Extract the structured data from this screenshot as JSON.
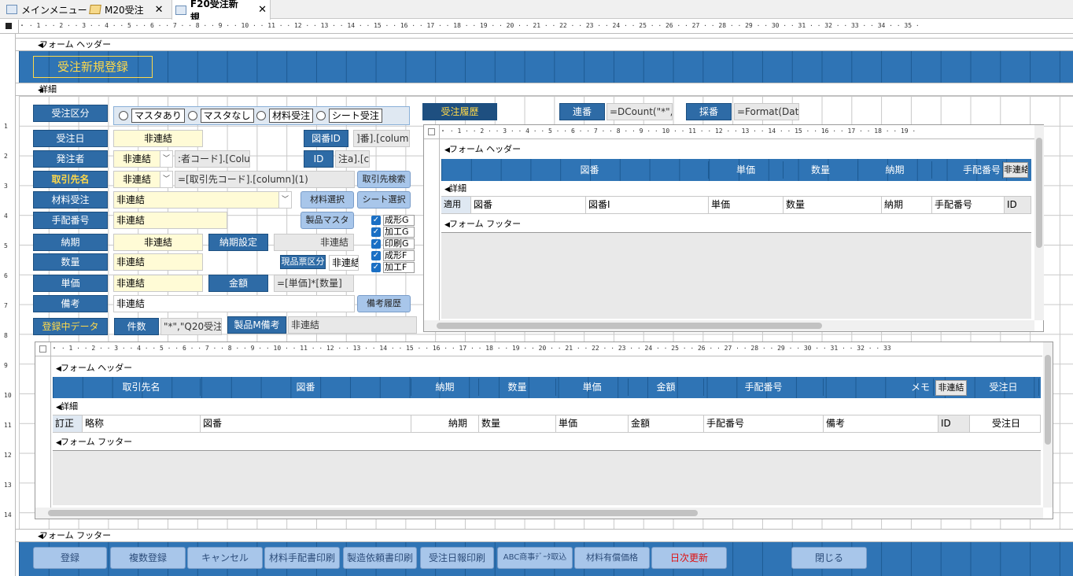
{
  "tabs": [
    {
      "label": "メインメニュー",
      "icon": "form-icon"
    },
    {
      "label": "M20受注",
      "icon": "query-icon"
    },
    {
      "label": "F20受注新規",
      "icon": "form-icon",
      "active": true
    }
  ],
  "ruler_main": "・ · 1 · · 2 · · 3 · · 4 · · 5 · · 6 · · 7 · · 8 · · 9 · · 10 · · 11 · · 12 · · 13 · · 14 · · 15 · · 16 · · 17 · · 18 · · 19 · · 20 · · 21 · · 22 · · 23 · · 24 · · 25 · · 26 · · 27 · · 28 · · 29 · · 30 · · 31 · · 32 · · 33 · · 34 · · 35 ·",
  "sections": {
    "form_header": "フォーム ヘッダー",
    "detail": "詳細",
    "form_footer": "フォーム フッター"
  },
  "header": {
    "title": "受注新規登録"
  },
  "detail": {
    "order_type_label": "受注区分",
    "order_type_options": [
      "マスタあり",
      "マスタなし",
      "材料受注",
      "シート受注"
    ],
    "history_label": "受注履歴",
    "serial_label": "連番",
    "serial_value": "=DCount(\"*\",",
    "saiban_label": "採番",
    "saiban_value": "=Format(Dat",
    "order_date_label": "受注日",
    "order_date_value": "非連結",
    "drawing_id_label": "図番ID",
    "drawing_id_value": "]番].[columr",
    "orderer_label": "発注者",
    "orderer_value": "非連結",
    "orderer_code": ":者コード].[Colur",
    "id_label": "ID",
    "id_value": "注a].[cc",
    "client_label": "取引先名",
    "client_value": "非連結",
    "client_code": "=[取引先コード].[column](1)",
    "client_search_btn": "取引先検索",
    "material_label": "材料受注",
    "material_value": "非連結",
    "material_select_btn": "材料選択",
    "sheet_select_btn": "シート選択",
    "arrange_label": "手配番号",
    "arrange_value": "非連結",
    "product_master_btn": "製品マスタ",
    "checks": [
      "成形G",
      "加工G",
      "印刷G",
      "成形F",
      "加工F"
    ],
    "delivery_label": "納期",
    "delivery_value": "非連結",
    "delivery_set_label": "納期設定",
    "delivery_set_value": "非連結",
    "qty_label": "数量",
    "qty_value": "非連結",
    "genpin_label": "現品票区分",
    "genpin_value": "非連結",
    "price_label": "単価",
    "price_value": "非連結",
    "amount_label": "金額",
    "amount_value": "=[単価]*[数量]",
    "remarks_label": "備考",
    "remarks_value": "非連結",
    "remarks_history_btn": "備考履歴",
    "registering_label": "登録中データ",
    "count_label": "件数",
    "count_value": "\"*\",\"Q20受注",
    "product_remarks_label": "製品M備考",
    "product_remarks_value": "非連結"
  },
  "sub1": {
    "ruler": "・ · 1 · · 2 · · 3 · · 4 · · 5 · · 6 · · 7 · · 8 · · 9 · · 10 · · 11 · · 12 · · 13 · · 14 · · 15 · · 16 · · 17 · · 18 · · 19 ·",
    "headers": [
      "図番",
      "単価",
      "数量",
      "納期",
      "手配番号"
    ],
    "header_unbound": "非連絡",
    "detail_cells": [
      "適用",
      "図番",
      "図番I",
      "単価",
      "数量",
      "納期",
      "手配番号",
      "ID"
    ]
  },
  "sub2": {
    "ruler": "・ · 1 · · 2 · · 3 · · 4 · · 5 · · 6 · · 7 · · 8 · · 9 · · 10 · · 11 · · 12 · · 13 · · 14 · · 15 · · 16 · · 17 · · 18 · · 19 · · 20 · · 21 · · 22 · · 23 · · 24 · · 25 · · 26 · · 27 · · 28 · · 29 · · 30 · · 31 · · 32 · · 33",
    "headers": [
      "取引先名",
      "図番",
      "納期",
      "数量",
      "単価",
      "金額",
      "手配番号",
      "メモ",
      "非連結",
      "受注日"
    ],
    "detail_cells": [
      "訂正",
      "略称",
      "図番",
      "納期",
      "数量",
      "単価",
      "金額",
      "手配番号",
      "備考",
      "ID",
      "受注日"
    ]
  },
  "footer_buttons": [
    "登録",
    "複数登録",
    "キャンセル",
    "材料手配書印刷",
    "製造依頼書印刷",
    "受注日報印刷",
    "ABC商事ﾃﾞｰﾀ取込",
    "材料有償価格",
    "日次更新",
    "閉じる"
  ],
  "colors": {
    "accent": "#2f74b5",
    "label_bg": "#2e6ba6",
    "field_bg": "#fffbd6",
    "title_text": "#ffd94a",
    "danger_text": "#e01010"
  }
}
